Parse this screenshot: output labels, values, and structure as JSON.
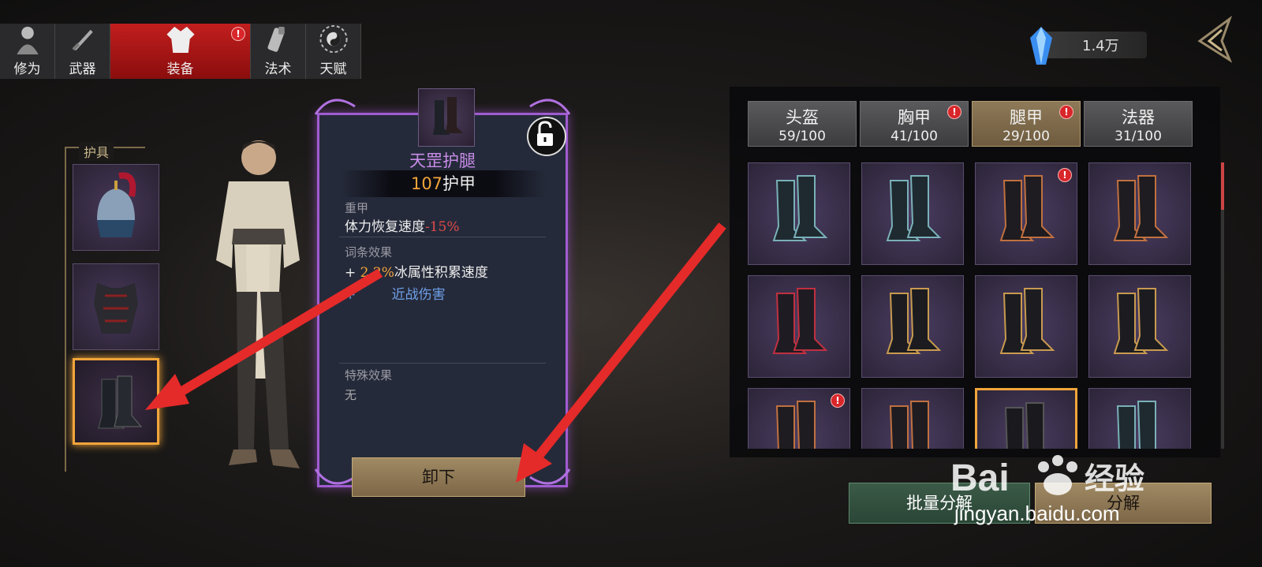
{
  "top_tabs": [
    {
      "label": "修为",
      "icon": "figure-icon",
      "active": false,
      "alert": false
    },
    {
      "label": "武器",
      "icon": "sword-icon",
      "active": false,
      "alert": false
    },
    {
      "label": "装备",
      "icon": "robe-icon",
      "active": true,
      "alert": true
    },
    {
      "label": "法术",
      "icon": "scroll-icon",
      "active": false,
      "alert": false
    },
    {
      "label": "天赋",
      "icon": "taiji-icon",
      "active": false,
      "alert": false
    }
  ],
  "alert_glyph": "!",
  "currency": {
    "amount": "1.4万",
    "icon": "crystal-icon"
  },
  "gear": {
    "title": "护具",
    "slots": [
      "helmet",
      "chest-armor",
      "boots"
    ],
    "selected": "boots"
  },
  "detail": {
    "name": "天罡护腿",
    "armor_value": "107",
    "armor_label": "护甲",
    "type_label": "重甲",
    "penalty_prefix": "体力恢复速度",
    "penalty_value": "-15%",
    "affix_label": "词条效果",
    "affix_1_prefix": "+ ",
    "affix_1_value": "2.2%",
    "affix_1_suffix": "冰属性积累速度",
    "affix_2_prefix": "+ ",
    "affix_2_text": "近战伤害",
    "special_label": "特殊效果",
    "special_value": "无",
    "unequip_label": "卸下"
  },
  "categories": [
    {
      "name": "头盔",
      "count": "59/100",
      "active": false,
      "alert": false
    },
    {
      "name": "胸甲",
      "count": "41/100",
      "active": false,
      "alert": true
    },
    {
      "name": "腿甲",
      "count": "29/100",
      "active": true,
      "alert": true
    },
    {
      "name": "法器",
      "count": "31/100",
      "active": false,
      "alert": false
    }
  ],
  "items": [
    {
      "style": "teal",
      "alert": false,
      "selected": false
    },
    {
      "style": "teal",
      "alert": false,
      "selected": false
    },
    {
      "style": "bronze",
      "alert": true,
      "selected": false
    },
    {
      "style": "bronze",
      "alert": false,
      "selected": false
    },
    {
      "style": "red",
      "alert": false,
      "selected": false
    },
    {
      "style": "gold",
      "alert": false,
      "selected": false
    },
    {
      "style": "gold",
      "alert": false,
      "selected": false
    },
    {
      "style": "gold",
      "alert": false,
      "selected": false
    },
    {
      "style": "bronze",
      "alert": true,
      "selected": false
    },
    {
      "style": "bronze",
      "alert": false,
      "selected": false
    },
    {
      "style": "black",
      "alert": false,
      "selected": true
    },
    {
      "style": "teal",
      "alert": false,
      "selected": false
    }
  ],
  "actions": {
    "batch": "批量分解",
    "decompose": "分解"
  },
  "watermark": {
    "brand": "Bai",
    "suffix": "经验",
    "url": "jingyan.baidu.com"
  },
  "colors": {
    "accent_gold": "#f2a53a",
    "rarity_purple": "#a05cd0",
    "alert_red": "#d9262a",
    "annotation_arrow": "#e52a2a"
  }
}
